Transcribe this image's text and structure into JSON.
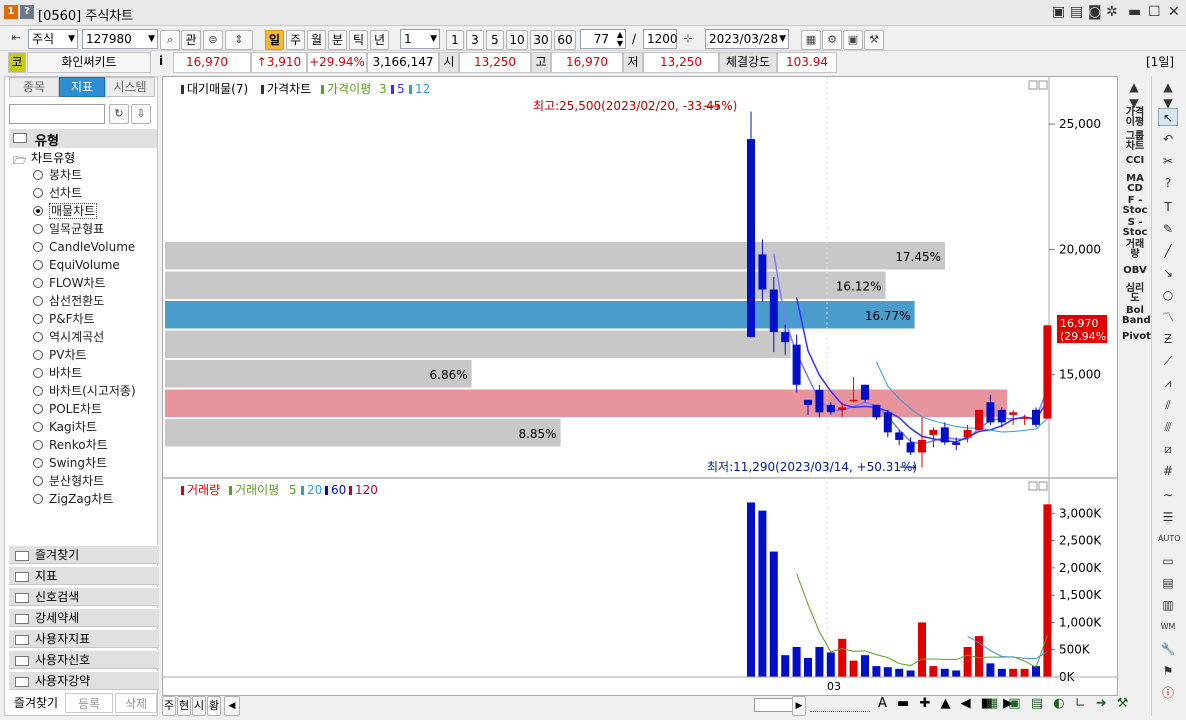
{
  "title": {
    "badge1": "1",
    "badge2": "?",
    "window_title": "[0560] 주식차트"
  },
  "toolbar": {
    "market": "주식",
    "code": "127980",
    "btn_gwan": "관",
    "periods": [
      "일",
      "주",
      "월",
      "분",
      "틱",
      "년"
    ],
    "active_period": "일",
    "interval_select": "1",
    "intervals": [
      "1",
      "3",
      "5",
      "10",
      "30",
      "60"
    ],
    "view_count": "77",
    "slash": "/",
    "total_count": "1200",
    "date": "2023/03/28"
  },
  "infobar": {
    "market_badge": "코",
    "stock_name": "화인써키트",
    "info_btn": "i",
    "price": "16,970",
    "change": "↑3,910",
    "change_pct": "+29.94%",
    "volume": "3,166,147",
    "open_label": "시",
    "open": "13,250",
    "high_label": "고",
    "high": "16,970",
    "low_label": "저",
    "low": "13,250",
    "strength_label": "체결강도",
    "strength": "103.94",
    "period_badge": "[1일]"
  },
  "leftpanel": {
    "tabs": [
      "종목",
      "지표",
      "시스템"
    ],
    "active_tab": "지표",
    "group_title": "유형",
    "subgroup": "차트유형",
    "items": [
      "봉차트",
      "선차트",
      "매물차트",
      "일목균형표",
      "CandleVolume",
      "EquiVolume",
      "FLOW차트",
      "삼선전환도",
      "P&F차트",
      "역시계곡선",
      "PV차트",
      "바차트",
      "바차트(시고저종)",
      "POLE차트",
      "Kagi차트",
      "Renko차트",
      "Swing차트",
      "분산형차트",
      "ZigZag차트"
    ],
    "selected_item": "매물차트",
    "folders": [
      "즐겨찾기",
      "지표",
      "신호검색",
      "강세약세",
      "사용자지표",
      "사용자신호",
      "사용자강약"
    ],
    "bottom_tabs": [
      "즐겨찾기",
      "등록",
      "삭제"
    ]
  },
  "chart": {
    "legend_top": {
      "vp": "대기매물(7)",
      "price": "가격차트",
      "ma": "가격이평",
      "ma1": "3",
      "ma2": "5",
      "ma3": "12"
    },
    "legend_bottom": {
      "vol": "거래량",
      "vma": "거래이평",
      "v1": "5",
      "v2": "20",
      "v3": "60",
      "v4": "120"
    },
    "high_annotation": "최고:25,500(2023/02/20, -33.45%)",
    "low_annotation": "최저:11,290(2023/03/14, +50.31%)",
    "price_axis": [
      "25,000",
      "20,000",
      "15,000"
    ],
    "volume_axis": [
      "3,000K",
      "2,500K",
      "2,000K",
      "1,500K",
      "1,000K",
      "500K",
      "0K"
    ],
    "current_price_label": "16,970",
    "current_pct_label": "(29.94%)",
    "x_label": "03",
    "colors": {
      "up": "#e00000",
      "down": "#0010c8",
      "vp_gray": "#c8c8c8",
      "vp_blue": "#4a9ccc",
      "vp_red": "#e8949c",
      "ma3": "#7b7bff",
      "ma5": "#3333ff",
      "ma12": "#2aa0d8",
      "vma20": "#3a8fd6",
      "vma5": "#5aa020"
    },
    "volume_profile": [
      {
        "pct": "17.45%",
        "share": 0.1745,
        "color": "gray"
      },
      {
        "pct": "16.12%",
        "share": 0.1612,
        "color": "gray"
      },
      {
        "pct": "16.77%",
        "share": 0.1677,
        "color": "blue"
      },
      {
        "pct": "",
        "share": 0.14,
        "color": "gray"
      },
      {
        "pct": "6.86%",
        "share": 0.0686,
        "color": "gray"
      },
      {
        "pct": "",
        "share": 0.19,
        "color": "red"
      },
      {
        "pct": "8.85%",
        "share": 0.0885,
        "color": "gray"
      }
    ]
  },
  "chart_data": {
    "type": "candlestick",
    "candles": [
      {
        "o": 16500,
        "h": 25500,
        "l": 16500,
        "c": 24400,
        "dir": "down_on_chart"
      },
      {
        "o": 19800,
        "h": 20400,
        "l": 17900,
        "c": 18400
      },
      {
        "o": 18400,
        "h": 18900,
        "l": 15900,
        "c": 16700
      },
      {
        "o": 16700,
        "h": 17000,
        "l": 15800,
        "c": 16300
      },
      {
        "o": 16200,
        "h": 16600,
        "l": 14300,
        "c": 14600
      },
      {
        "o": 14000,
        "h": 14000,
        "l": 13400,
        "c": 13800
      },
      {
        "o": 14400,
        "h": 14600,
        "l": 13300,
        "c": 13500
      },
      {
        "o": 13800,
        "h": 13900,
        "l": 13400,
        "c": 13500
      },
      {
        "o": 13600,
        "h": 13900,
        "l": 13300,
        "c": 13700
      },
      {
        "o": 14000,
        "h": 14900,
        "l": 13900,
        "c": 14000
      },
      {
        "o": 14600,
        "h": 14600,
        "l": 13900,
        "c": 14000
      },
      {
        "o": 13800,
        "h": 13800,
        "l": 13200,
        "c": 13300
      },
      {
        "o": 13500,
        "h": 13600,
        "l": 12500,
        "c": 12700
      },
      {
        "o": 12700,
        "h": 12800,
        "l": 12200,
        "c": 12400
      },
      {
        "o": 12300,
        "h": 12500,
        "l": 11800,
        "c": 11900
      },
      {
        "o": 11900,
        "h": 13300,
        "l": 11300,
        "c": 12400
      },
      {
        "o": 12600,
        "h": 12900,
        "l": 12100,
        "c": 12800
      },
      {
        "o": 12900,
        "h": 13100,
        "l": 12200,
        "c": 12300
      },
      {
        "o": 12300,
        "h": 12500,
        "l": 12000,
        "c": 12200
      },
      {
        "o": 12500,
        "h": 13000,
        "l": 12300,
        "c": 12800
      },
      {
        "o": 12800,
        "h": 13600,
        "l": 12700,
        "c": 13600
      },
      {
        "o": 13900,
        "h": 14200,
        "l": 13000,
        "c": 13100
      },
      {
        "o": 13600,
        "h": 13700,
        "l": 12900,
        "c": 13100
      },
      {
        "o": 13400,
        "h": 13600,
        "l": 13000,
        "c": 13500
      },
      {
        "o": 13300,
        "h": 13400,
        "l": 13000,
        "c": 13300
      },
      {
        "o": 13600,
        "h": 13700,
        "l": 12900,
        "c": 13000
      },
      {
        "o": 13250,
        "h": 16970,
        "l": 13250,
        "c": 16970
      }
    ],
    "volume": [
      3200,
      3050,
      2300,
      400,
      550,
      350,
      550,
      450,
      700,
      300,
      400,
      200,
      180,
      150,
      120,
      1000,
      200,
      150,
      120,
      550,
      750,
      250,
      150,
      150,
      150,
      200,
      3166
    ],
    "ylim_price": [
      11000,
      26000
    ],
    "ylim_volume": [
      0,
      3300
    ]
  },
  "bottombar": {
    "tabs": [
      "주",
      "현",
      "시",
      "황"
    ]
  }
}
